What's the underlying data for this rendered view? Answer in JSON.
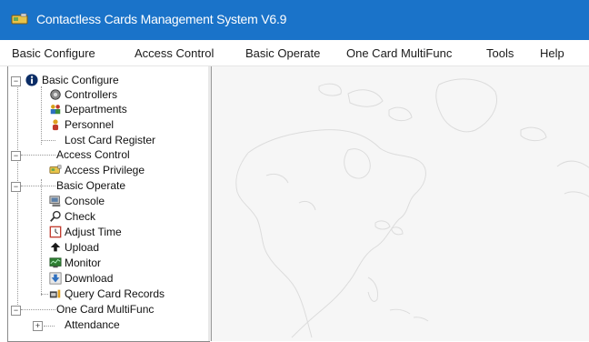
{
  "window": {
    "title": "Contactless Cards Management System  V6.9"
  },
  "menu": {
    "items": [
      {
        "label": "Basic Configure"
      },
      {
        "label": "Access Control"
      },
      {
        "label": "Basic Operate"
      },
      {
        "label": "One Card MultiFunc"
      },
      {
        "label": "Tools"
      },
      {
        "label": "Help"
      }
    ]
  },
  "tree": {
    "basic_configure": {
      "label": "Basic Configure",
      "children": [
        "Controllers",
        "Departments",
        "Personnel",
        "Lost Card Register"
      ]
    },
    "access_control": {
      "label": "Access Control",
      "children": [
        "Access Privilege"
      ]
    },
    "basic_operate": {
      "label": "Basic Operate",
      "children": [
        "Console",
        "Check",
        "Adjust Time",
        "Upload",
        "Monitor",
        "Download",
        "Query Card Records"
      ]
    },
    "one_card": {
      "label": "One Card MultiFunc",
      "children": [
        "Attendance"
      ]
    }
  },
  "icons": {
    "app": "card-reader-icon",
    "basic_configure": "info-icon",
    "controllers": "controller-icon",
    "departments": "department-icon",
    "personnel": "person-icon",
    "access_privilege": "card-key-icon",
    "console": "console-icon",
    "check": "magnifier-icon",
    "adjust_time": "clock-icon",
    "upload": "upload-icon",
    "monitor": "monitor-icon",
    "download": "download-icon",
    "query_card_records": "query-records-icon"
  },
  "colors": {
    "titlebar": "#1a73c9",
    "map_background": "#f6f6f6"
  }
}
